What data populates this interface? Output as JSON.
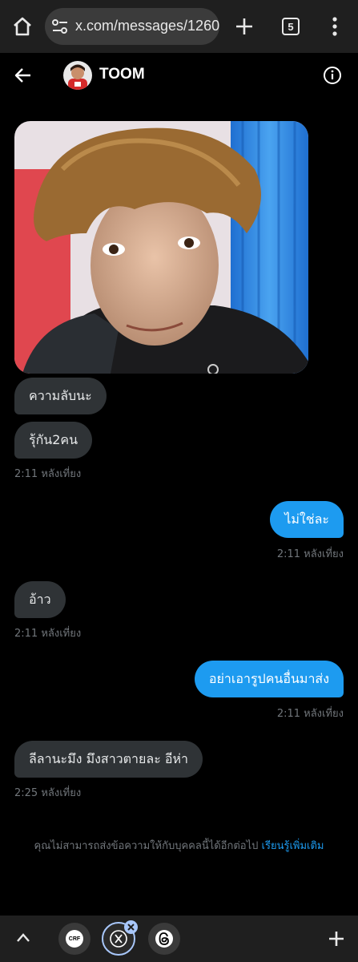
{
  "browser": {
    "url": "x.com/messages/1260",
    "tab_count": "5"
  },
  "header": {
    "name": "TOOM"
  },
  "messages": [
    {
      "text": "ความลับนะ",
      "side": "in"
    },
    {
      "text": "รุ้กัน2คน",
      "side": "in"
    },
    {
      "time": "2:11 หลังเที่ยง"
    },
    {
      "text": "ไม่ใช่ละ",
      "side": "out"
    },
    {
      "time": "2:11 หลังเที่ยง"
    },
    {
      "text": "อ้าว",
      "side": "in"
    },
    {
      "time": "2:11 หลังเที่ยง"
    },
    {
      "text": "อย่าเอารูปคนอื่นมาส่ง",
      "side": "out"
    },
    {
      "time": "2:11 หลังเที่ยง"
    },
    {
      "text": "ลีลานะมึง มึงสาวตายละ  อีห่า",
      "side": "in"
    },
    {
      "time": "2:25 หลังเที่ยง"
    }
  ],
  "notice": {
    "text": "คุณไม่สามารถส่งข้อความให้กับบุคคลนี้ได้อีกต่อไป",
    "link": "เรียนรู้เพิ่มเติม"
  },
  "bottom_tabs": {
    "crf_label": "CRF"
  },
  "colors": {
    "accent": "#1d9bf0",
    "bubble_in": "#2f3336",
    "muted": "#71767b"
  }
}
